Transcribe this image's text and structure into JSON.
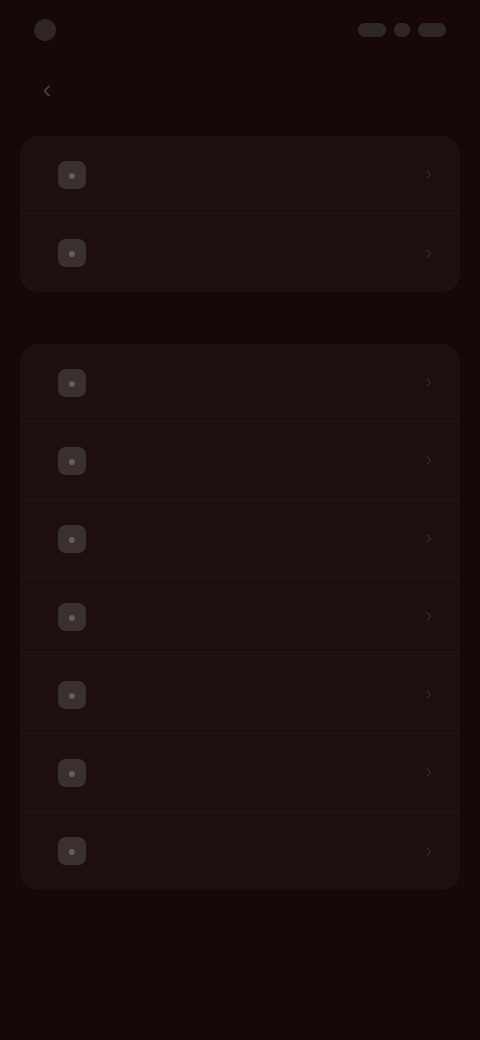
{
  "status": {
    "time": "",
    "carrier": ""
  },
  "header": {
    "title": "",
    "back_glyph": "‹"
  },
  "groups": [
    {
      "label": "",
      "items": [
        {
          "label": "",
          "icon": "settings-icon"
        },
        {
          "label": "",
          "icon": "settings-icon"
        }
      ]
    },
    {
      "label": "",
      "items": [
        {
          "label": "",
          "icon": "settings-icon"
        },
        {
          "label": "",
          "icon": "settings-icon"
        },
        {
          "label": "",
          "icon": "settings-icon"
        },
        {
          "label": "",
          "icon": "settings-icon"
        },
        {
          "label": "",
          "icon": "settings-icon"
        },
        {
          "label": "",
          "icon": "settings-icon"
        },
        {
          "label": "",
          "icon": "settings-icon"
        }
      ]
    }
  ],
  "footer": {
    "link": ""
  },
  "colors": {
    "background": "#150807",
    "card": "#1d0f0d"
  }
}
